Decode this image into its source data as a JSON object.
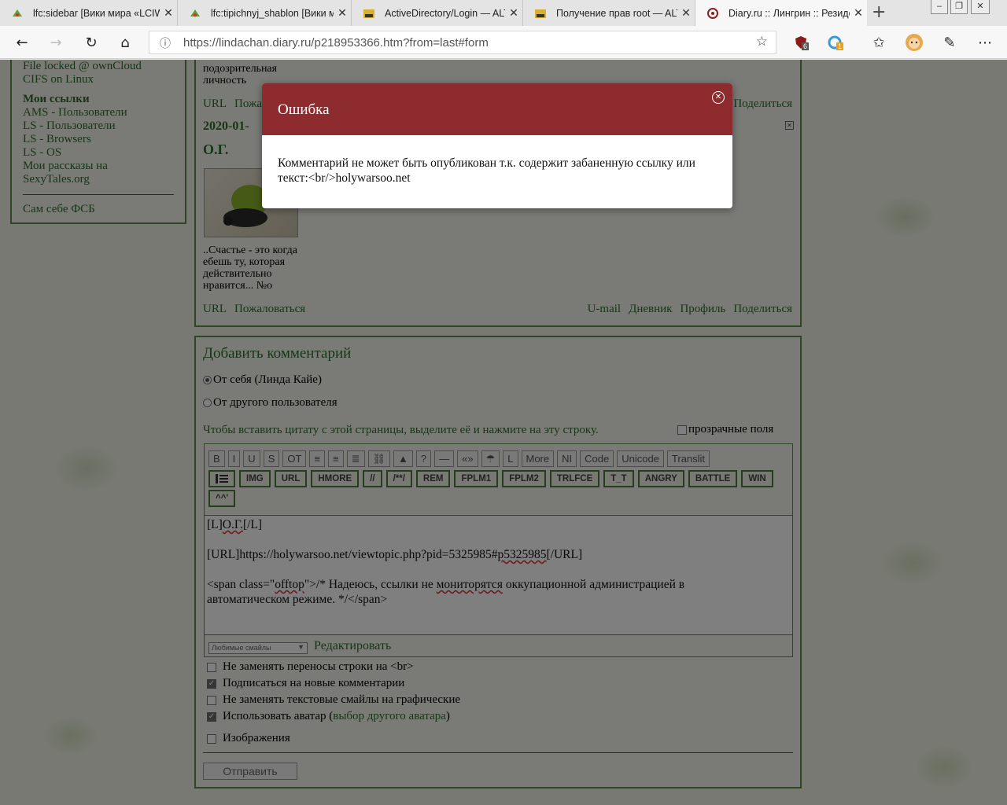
{
  "browser": {
    "tabs": [
      {
        "title": "lfc:sidebar [Вики мира «LCIW",
        "active": false
      },
      {
        "title": "lfc:tipichnyj_shablon [Вики м",
        "active": false
      },
      {
        "title": "ActiveDirectory/Login — ALT",
        "active": false
      },
      {
        "title": "Получение прав root — ALT",
        "active": false
      },
      {
        "title": "Diary.ru :: Лингрин :: Резиде",
        "active": true
      }
    ],
    "new_tab": "+",
    "close_glyph": "✕",
    "url": "https://lindachan.diary.ru/p218953366.htm?from=last#form",
    "badge_counts": {
      "ublock": "6",
      "ext": "1"
    }
  },
  "sidebar": {
    "top_cut": "File locked @ ownCloud",
    "items1": [
      "CIFS on Linux"
    ],
    "links_heading": "Мои ссылки",
    "links": [
      "AMS - Пользователи",
      "LS - Пользователи",
      "LS - Browsers",
      "LS - OS",
      "Мои рассказы на SexyTales.org"
    ],
    "bottom": "Сам себе ФСБ"
  },
  "post": {
    "prev_text": "подозрительная\nличность",
    "prev_links_left": [
      "URL",
      "Пожал"
    ],
    "prev_links_right": [
      "Поделиться"
    ],
    "date": "2020-01-",
    "author": "О.Г.",
    "signature": "..Счастье - это когда ебешь ту, которая действительно нравится... №о",
    "links_left": [
      "URL",
      "Пожаловаться"
    ],
    "links_right": [
      "U-mail",
      "Дневник",
      "Профиль",
      "Поделиться"
    ]
  },
  "comment": {
    "title": "Добавить комментарий",
    "radio_self": "От себя (Линда Кайе)",
    "radio_other": "От другого пользователя",
    "quote_hint": "Чтобы вставить цитату с этой страницы, выделите её и нажмите на эту строку.",
    "transparent_label": "прозрачные поля",
    "toolbar_row1": [
      "B",
      "I",
      "U",
      "S",
      "OT",
      "≡",
      "≡",
      "≣",
      "⛓",
      "▲",
      "?",
      "—",
      "«»",
      "☂",
      "L",
      "More",
      "NI",
      "Code",
      "Unicode",
      "Translit"
    ],
    "toolbar_row2": [
      "IMG",
      "URL",
      "HMORE",
      "//",
      "/**/",
      "REM",
      "FPLM1",
      "FPLM2",
      "TRLFCE",
      "T_T",
      "ANGRY",
      "BATTLE",
      "WIN"
    ],
    "toolbar_row3": [
      "^^'"
    ],
    "text_line1_a": "[L]",
    "text_line1_b": "О.Г.",
    "text_line1_c": "[/L]",
    "text_line2_a": "[URL]https://holywarsoo.net/viewtopic.php?pid=5325985#",
    "text_line2_b": "p5325985",
    "text_line2_c": "[/URL]",
    "text_line3_a": "<span class=\"",
    "text_line3_b": "offtop",
    "text_line3_c": "\">/* Надеюсь, ссылки не ",
    "text_line3_d": "мониторятся",
    "text_line3_e": " оккупационной администрацией в",
    "text_line4": "автоматическом режиме. */</span>",
    "smiles_select": "Любимые смайлы",
    "edit_link": "Редактировать",
    "options": [
      {
        "label": "Не заменять переносы строки на <br>",
        "checked": false
      },
      {
        "label": "Подписаться на новые комментарии",
        "checked": true
      },
      {
        "label": "Не заменять текстовые смайлы на графические",
        "checked": false
      }
    ],
    "avatar_label": "Использовать аватар (",
    "avatar_link": "выбор другого аватара",
    "avatar_close": ")",
    "images_label": "Изображения",
    "submit": "Отправить"
  },
  "dialog": {
    "title": "Ошибка",
    "message": "Комментарий не может быть опубликован т.к. содержит забаненную ссылку или текст:<br/>holywarsoo.net",
    "close_glyph": "✕"
  }
}
